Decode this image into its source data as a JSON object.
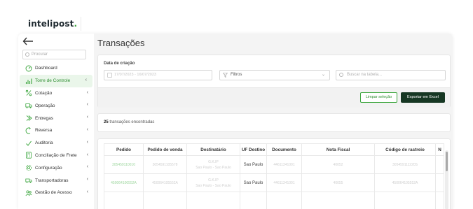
{
  "brand": {
    "name": "intelipost",
    "dot": "."
  },
  "sidebar": {
    "search_placeholder": "Procurar",
    "items": [
      {
        "label": "Dashboard",
        "icon": "dashboard-icon",
        "chevron": false,
        "active": false
      },
      {
        "label": "Torre de Controle",
        "icon": "chart-bars-icon",
        "chevron": true,
        "active": true
      },
      {
        "label": "Cotação",
        "icon": "percent-icon",
        "chevron": true,
        "active": false
      },
      {
        "label": "Operação",
        "icon": "truck-icon",
        "chevron": true,
        "active": false
      },
      {
        "label": "Entregas",
        "icon": "delivery-icon",
        "chevron": true,
        "active": false
      },
      {
        "label": "Reversa",
        "icon": "reverse-icon",
        "chevron": true,
        "active": false
      },
      {
        "label": "Auditoria",
        "icon": "audit-icon",
        "chevron": true,
        "active": false
      },
      {
        "label": "Conciliação de Frete",
        "icon": "calculator-icon",
        "chevron": true,
        "active": false
      },
      {
        "label": "Configuração",
        "icon": "gear-icon",
        "chevron": true,
        "active": false
      },
      {
        "label": "Transportadoras",
        "icon": "carrier-icon",
        "chevron": true,
        "active": false
      },
      {
        "label": "Gestão de Acesso",
        "icon": "users-icon",
        "chevron": true,
        "active": false
      }
    ]
  },
  "main": {
    "title": "Transações",
    "filters": {
      "date_label": "Data de criação",
      "date_value": "17/07/2023 - 16/07/2023",
      "filtros_label": "Filtros",
      "search_placeholder": "Buscar na tabela...",
      "clear_button": "Limpar seleção",
      "export_button": "Exportar em Excel"
    },
    "results": {
      "count": "25",
      "text": "transações encontradas"
    },
    "table": {
      "columns": [
        "Pedido",
        "Pedido de venda",
        "Destinatário",
        "UF Destino",
        "Documento",
        "Nota Fiscal",
        "Código de rastreio",
        "N"
      ],
      "rows": [
        {
          "pedido": "305459110010",
          "pedido_venda": "3054591105578",
          "destinatario_1": "G.K.IP",
          "destinatario_2": "Sao Paulo - Sao Paulo",
          "uf": "Sao Paulo",
          "documento": "44611341001",
          "nota_fiscal": "40052",
          "rastreio": "305459111220S"
        },
        {
          "pedido": "450064100552A",
          "pedido_venda": "450064105552A",
          "destinatario_1": "G.K.IP",
          "destinatario_2": "Sao Paulo - Sao Paulo",
          "uf": "Sao Paulo",
          "documento": "44611341001",
          "nota_fiscal": "40055",
          "rastreio": "450064105552A"
        },
        {
          "pedido": "",
          "pedido_venda": "",
          "destinatario_1": "",
          "destinatario_2": "",
          "uf": "",
          "documento": "",
          "nota_fiscal": "",
          "rastreio": ""
        }
      ]
    }
  },
  "colors": {
    "accent": "#3aa53c",
    "dark_button": "#163723",
    "active_bg": "#eaf6ea"
  }
}
